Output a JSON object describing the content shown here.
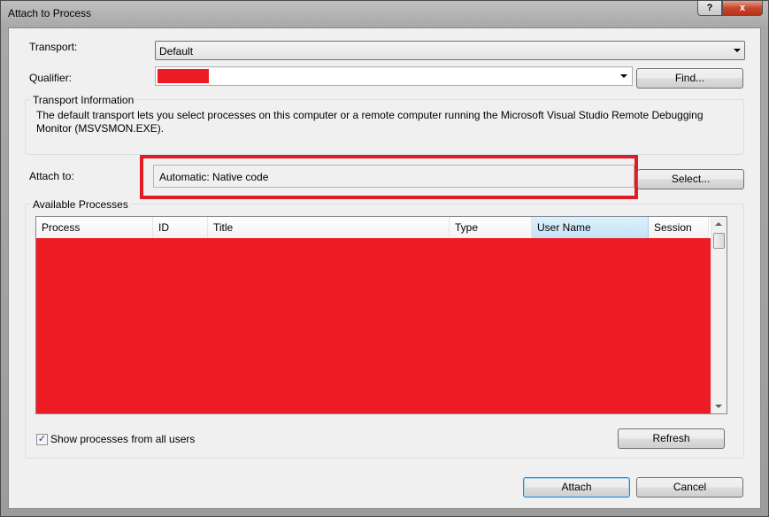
{
  "window": {
    "title": "Attach to Process",
    "help_label": "?",
    "close_label": "x"
  },
  "transport": {
    "label": "Transport:",
    "value": "Default"
  },
  "qualifier": {
    "label": "Qualifier:",
    "value": "",
    "find_button": "Find..."
  },
  "transport_info": {
    "title": "Transport Information",
    "line1": "The default transport lets you select processes on this computer or a remote computer running the Microsoft Visual Studio Remote Debugging",
    "line2": "Monitor (MSVSMON.EXE)."
  },
  "attach_to": {
    "label": "Attach to:",
    "value": "Automatic: Native code",
    "select_button": "Select..."
  },
  "available_processes": {
    "title": "Available Processes",
    "columns": [
      "Process",
      "ID",
      "Title",
      "Type",
      "User Name",
      "Session"
    ],
    "sorted_column": "User Name"
  },
  "show_all_users": {
    "label": "Show processes from all users",
    "checked": true,
    "check_glyph": "✓"
  },
  "buttons": {
    "refresh": "Refresh",
    "attach": "Attach",
    "cancel": "Cancel"
  },
  "colors": {
    "redaction": "#ed1c24",
    "highlight_box": "#e21c26",
    "sorted_header": "#c4e3f7"
  }
}
